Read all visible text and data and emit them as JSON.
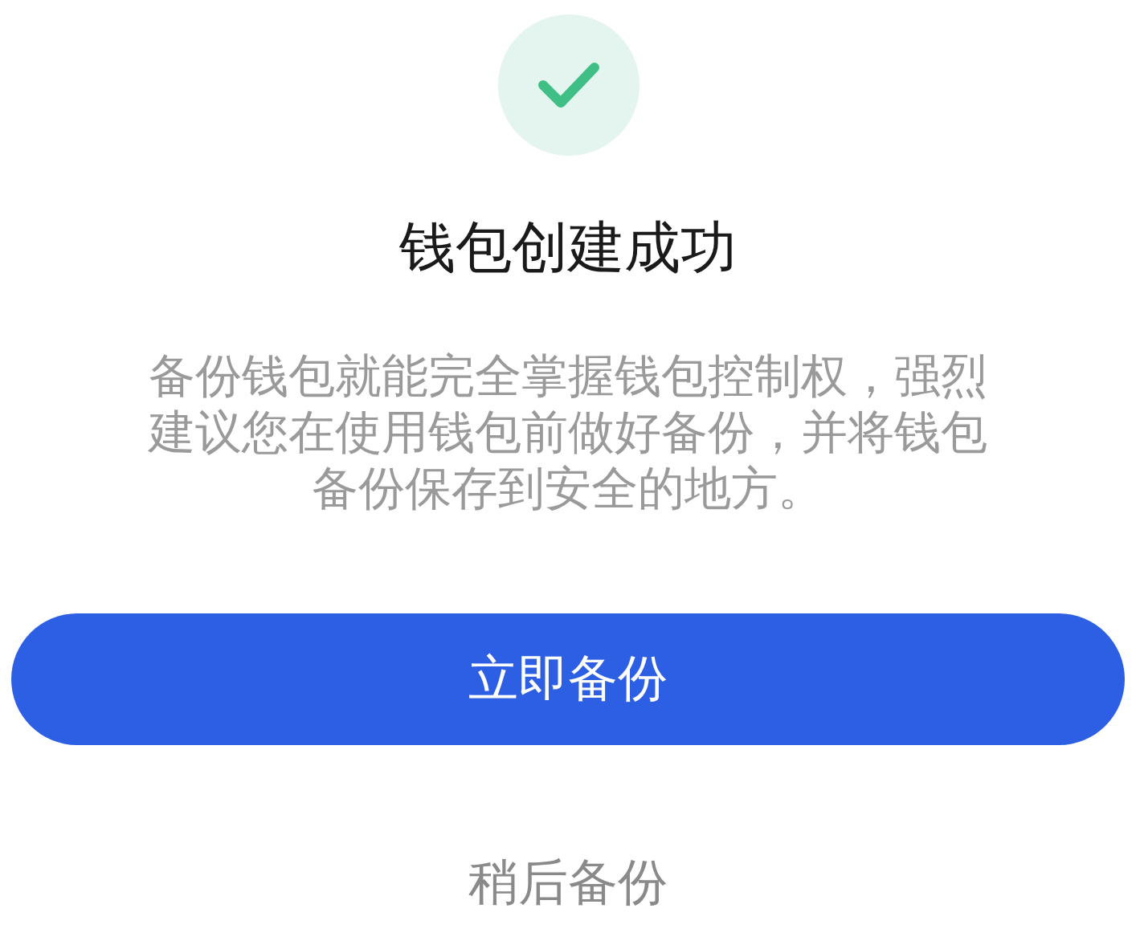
{
  "title": "钱包创建成功",
  "description": "备份钱包就能完全掌握钱包控制权，强烈建议您在使用钱包前做好备份，并将钱包备份保存到安全的地方。",
  "primary_button": "立即备份",
  "secondary_button": "稍后备份"
}
